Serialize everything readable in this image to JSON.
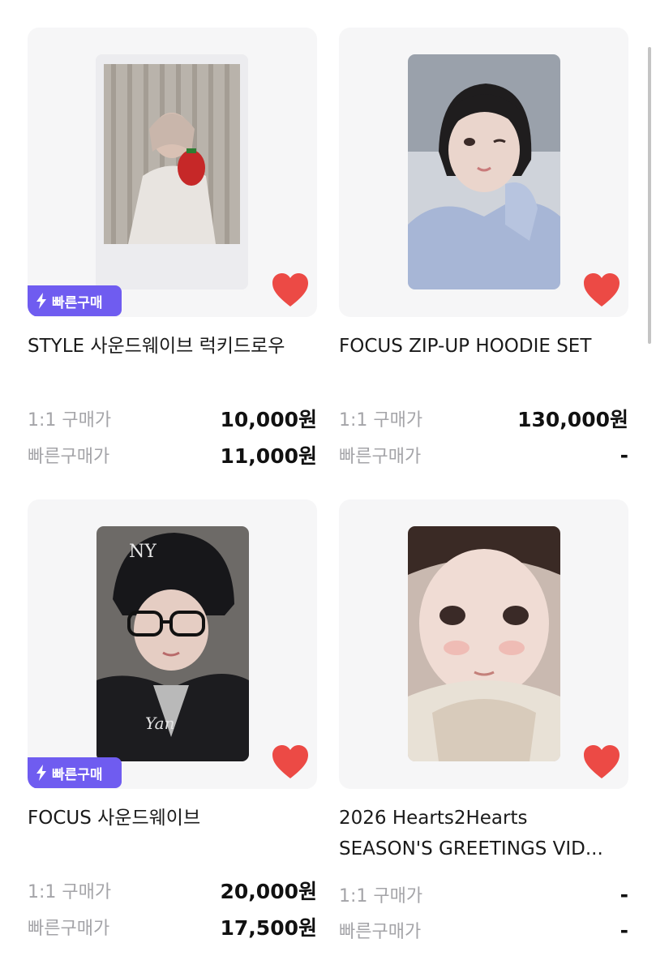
{
  "colors": {
    "accent": "#6f5cf0",
    "heart": "#ec4a45",
    "card_bg": "#f6f6f7",
    "label": "#a4a4a8"
  },
  "products": [
    {
      "title_lines": [
        "STYLE 사운드웨이브 럭키드로우"
      ],
      "badge": "빠른구매",
      "one_to_one_label": "1:1 구매가",
      "one_to_one_price": "10,000원",
      "quick_label": "빠른구매가",
      "quick_price": "11,000원",
      "liked": true
    },
    {
      "title_lines": [
        "FOCUS ZIP-UP HOODIE SET"
      ],
      "badge": "",
      "one_to_one_label": "1:1 구매가",
      "one_to_one_price": "130,000원",
      "quick_label": "빠른구매가",
      "quick_price": "-",
      "liked": true
    },
    {
      "title_lines": [
        "FOCUS 사운드웨이브"
      ],
      "badge": "빠른구매",
      "one_to_one_label": "1:1 구매가",
      "one_to_one_price": "20,000원",
      "quick_label": "빠른구매가",
      "quick_price": "17,500원",
      "liked": true
    },
    {
      "title_lines": [
        "2026 Hearts2Hearts",
        "SEASON'S GREETINGS VID..."
      ],
      "badge": "",
      "one_to_one_label": "1:1 구매가",
      "one_to_one_price": "-",
      "quick_label": "빠른구매가",
      "quick_price": "-",
      "liked": true
    }
  ]
}
